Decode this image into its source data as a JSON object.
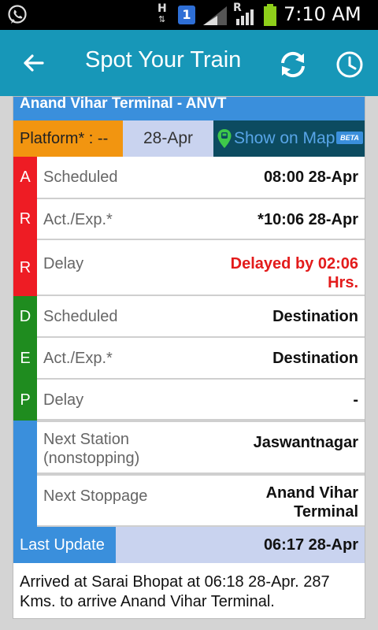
{
  "status_bar": {
    "network_h": "H",
    "sim_slot": "1",
    "roaming": "R",
    "time": "7:10 AM"
  },
  "app_bar": {
    "title": "Spot Your Train"
  },
  "station": {
    "title": "Anand Vihar Terminal - ANVT",
    "platform": "Platform* : --",
    "date": "28-Apr",
    "map_label": "Show on Map",
    "beta_badge": "BETA"
  },
  "arrival": {
    "side_letters": [
      "A",
      "R",
      "R"
    ],
    "rows": [
      {
        "label": "Scheduled",
        "value": "08:00 28-Apr"
      },
      {
        "label": "Act./Exp.*",
        "value": "*10:06 28-Apr"
      },
      {
        "label": "Delay",
        "value": "Delayed by 02:06 Hrs."
      }
    ]
  },
  "departure": {
    "side_letters": [
      "D",
      "E",
      "P"
    ],
    "rows": [
      {
        "label": "Scheduled",
        "value": "Destination"
      },
      {
        "label": "Act./Exp.*",
        "value": "Destination"
      },
      {
        "label": "Delay",
        "value": "-"
      }
    ]
  },
  "next": {
    "rows": [
      {
        "label": "Next Station (nonstopping)",
        "value": "Jaswantnagar"
      },
      {
        "label": "Next Stoppage",
        "value": "Anand Vihar Terminal"
      }
    ]
  },
  "last_update": {
    "label": "Last Update",
    "value": "06:17 28-Apr"
  },
  "message": "Arrived at Sarai Bhopat at 06:18 28-Apr. 287 Kms. to arrive Anand Vihar Terminal.",
  "colors": {
    "app_bar": "#1797b8",
    "arrival": "#ee1c24",
    "departure": "#1f8c1f",
    "accent_blue": "#3a8fdc",
    "platform": "#f29510",
    "delay_text": "#e31b1b"
  },
  "icons": [
    "whatsapp-icon",
    "back-arrow-icon",
    "refresh-icon",
    "history-clock-icon",
    "map-pin-icon"
  ]
}
